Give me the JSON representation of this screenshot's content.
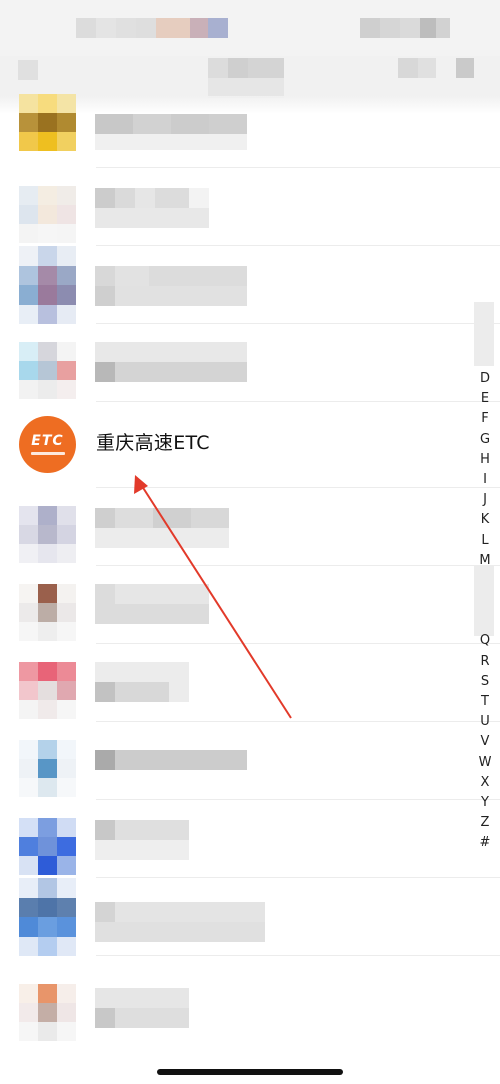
{
  "contact": {
    "name": "重庆高速ETC",
    "logo_text": "ETC"
  },
  "alphabet_index": [
    "D",
    "E",
    "F",
    "G",
    "H",
    "I",
    "J",
    "K",
    "L",
    "M",
    "",
    "",
    "",
    "Q",
    "R",
    "S",
    "T",
    "U",
    "V",
    "W",
    "X",
    "Y",
    "Z",
    "#"
  ],
  "colors": {
    "etc_orange": "#ee6d22",
    "arrow_red": "#e23a2a"
  },
  "icons": {
    "etc_avatar": "etc-logo-icon",
    "annotation": "red-arrow-icon"
  }
}
